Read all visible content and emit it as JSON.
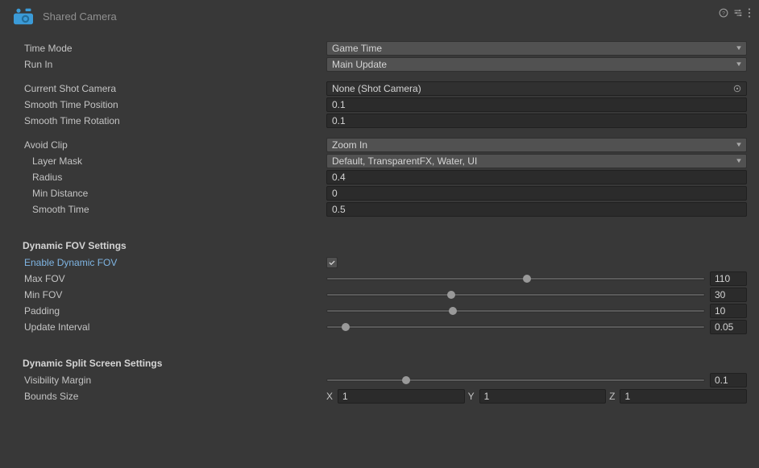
{
  "header": {
    "title": "Shared Camera"
  },
  "fields": {
    "timeMode": {
      "label": "Time Mode",
      "value": "Game Time"
    },
    "runIn": {
      "label": "Run In",
      "value": "Main Update"
    },
    "currentShotCamera": {
      "label": "Current Shot Camera",
      "value": "None (Shot Camera)"
    },
    "smoothTimePosition": {
      "label": "Smooth Time Position",
      "value": "0.1"
    },
    "smoothTimeRotation": {
      "label": "Smooth Time Rotation",
      "value": "0.1"
    },
    "avoidClip": {
      "label": "Avoid Clip",
      "value": "Zoom In"
    },
    "layerMask": {
      "label": "Layer Mask",
      "value": "Default, TransparentFX, Water, UI"
    },
    "radius": {
      "label": "Radius",
      "value": "0.4"
    },
    "minDistance": {
      "label": "Min Distance",
      "value": "0"
    },
    "smoothTime": {
      "label": "Smooth Time",
      "value": "0.5"
    }
  },
  "dynamicFov": {
    "header": "Dynamic FOV Settings",
    "enable": {
      "label": "Enable Dynamic FOV",
      "checked": true
    },
    "maxFov": {
      "label": "Max FOV",
      "value": "110",
      "pct": 53
    },
    "minFov": {
      "label": "Min FOV",
      "value": "30",
      "pct": 33
    },
    "padding": {
      "label": "Padding",
      "value": "10",
      "pct": 33.5
    },
    "updateInterval": {
      "label": "Update Interval",
      "value": "0.05",
      "pct": 5
    }
  },
  "splitScreen": {
    "header": "Dynamic Split Screen Settings",
    "visibilityMargin": {
      "label": "Visibility Margin",
      "value": "0.1",
      "pct": 21
    },
    "boundsSize": {
      "label": "Bounds Size",
      "x": "1",
      "y": "1",
      "z": "1"
    }
  }
}
